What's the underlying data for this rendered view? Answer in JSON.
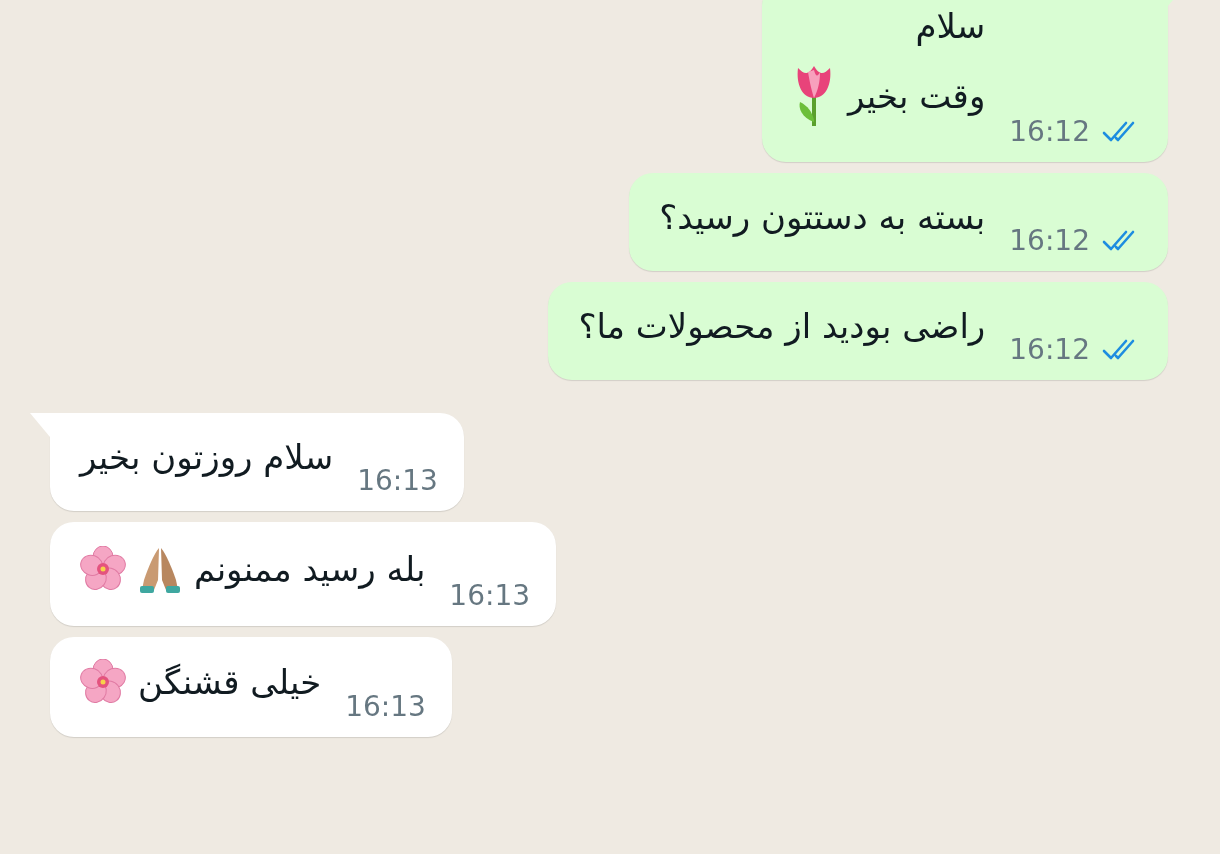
{
  "messages": [
    {
      "kind": "outgoing",
      "tail": true,
      "lines": [
        {
          "text": "سلام"
        },
        {
          "text": "وقت بخیر",
          "emoji": [
            {
              "kind": "tulip"
            }
          ]
        }
      ],
      "time": "16:12",
      "read": true
    },
    {
      "kind": "outgoing",
      "tail": false,
      "lines": [
        {
          "text": "بسته به دستتون رسید؟"
        }
      ],
      "time": "16:12",
      "read": true
    },
    {
      "kind": "outgoing",
      "tail": false,
      "lines": [
        {
          "text": "راضی بودید از محصولات ما؟"
        }
      ],
      "time": "16:12",
      "read": true
    },
    {
      "kind": "incoming",
      "tail": true,
      "lines": [
        {
          "text": "سلام روزتون بخیر"
        }
      ],
      "time": "16:13"
    },
    {
      "kind": "incoming",
      "tail": false,
      "lines": [
        {
          "text": "بله رسید ممنونم",
          "emoji": [
            {
              "kind": "praying-hands"
            },
            {
              "kind": "blossom"
            }
          ]
        }
      ],
      "time": "16:13"
    },
    {
      "kind": "incoming",
      "tail": false,
      "lines": [
        {
          "text": "خیلی قشنگن",
          "emoji": [
            {
              "kind": "blossom"
            }
          ]
        }
      ],
      "time": "16:13"
    }
  ]
}
